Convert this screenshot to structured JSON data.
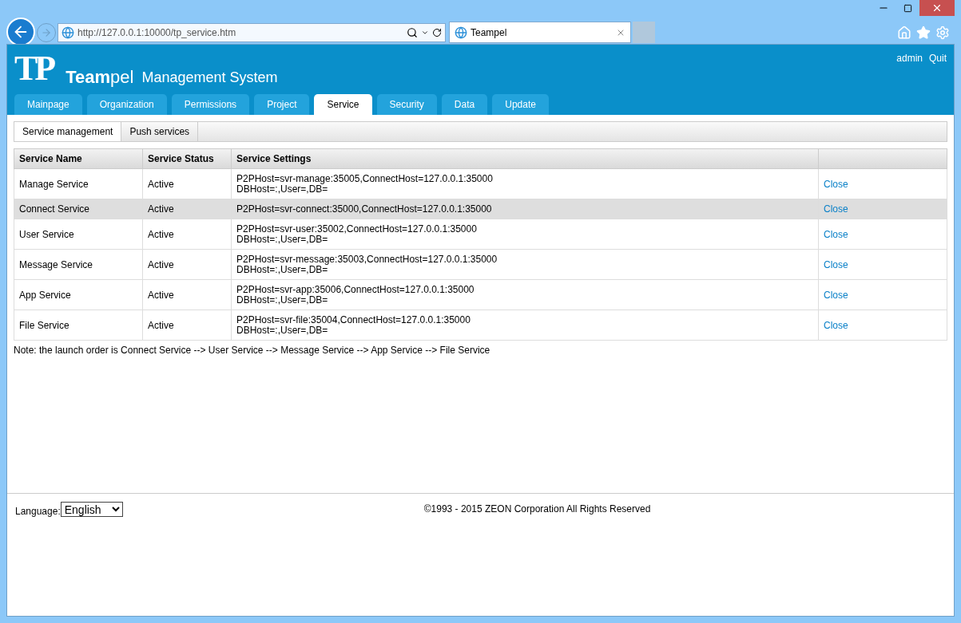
{
  "browser": {
    "url": "http://127.0.0.1:10000/tp_service.htm",
    "tab_title": "Teampel"
  },
  "header": {
    "logo": "TP",
    "brand": "**Team**pel",
    "subtitle": "Management System",
    "user": "admin",
    "quit": "Quit"
  },
  "nav_tabs": [
    {
      "label": "Mainpage",
      "selected": false
    },
    {
      "label": "Organization",
      "selected": false
    },
    {
      "label": "Permissions",
      "selected": false
    },
    {
      "label": "Project",
      "selected": false
    },
    {
      "label": "Service",
      "selected": true
    },
    {
      "label": "Security",
      "selected": false
    },
    {
      "label": "Data",
      "selected": false
    },
    {
      "label": "Update",
      "selected": false
    }
  ],
  "sub_tabs": [
    {
      "label": "Service management",
      "selected": true
    },
    {
      "label": "Push services",
      "selected": false
    }
  ],
  "table": {
    "columns": [
      "Service Name",
      "Service Status",
      "Service Settings"
    ],
    "rows": [
      {
        "name": "Manage Service",
        "status": "Active",
        "settings": [
          "P2PHost=svr-manage:35005,ConnectHost=127.0.0.1:35000",
          "DBHost=:,User=,DB="
        ],
        "action": "Close",
        "selected": false
      },
      {
        "name": "Connect Service",
        "status": "Active",
        "settings": [
          "P2PHost=svr-connect:35000,ConnectHost=127.0.0.1:35000"
        ],
        "action": "Close",
        "selected": true
      },
      {
        "name": "User Service",
        "status": "Active",
        "settings": [
          "P2PHost=svr-user:35002,ConnectHost=127.0.0.1:35000",
          "DBHost=:,User=,DB="
        ],
        "action": "Close",
        "selected": false
      },
      {
        "name": "Message Service",
        "status": "Active",
        "settings": [
          "P2PHost=svr-message:35003,ConnectHost=127.0.0.1:35000",
          "DBHost=:,User=,DB="
        ],
        "action": "Close",
        "selected": false
      },
      {
        "name": "App Service",
        "status": "Active",
        "settings": [
          "P2PHost=svr-app:35006,ConnectHost=127.0.0.1:35000",
          "DBHost=:,User=,DB="
        ],
        "action": "Close",
        "selected": false
      },
      {
        "name": "File Service",
        "status": "Active",
        "settings": [
          "P2PHost=svr-file:35004,ConnectHost=127.0.0.1:35000",
          "DBHost=:,User=,DB="
        ],
        "action": "Close",
        "selected": false
      }
    ]
  },
  "note": "Note: the launch order is Connect Service --> User Service --> Message Service --> App Service --> File Service",
  "footer": {
    "language_label": "Language:",
    "language": "English",
    "copyright": "©1993 - 2015 ZEON Corporation All Rights Reserved"
  }
}
